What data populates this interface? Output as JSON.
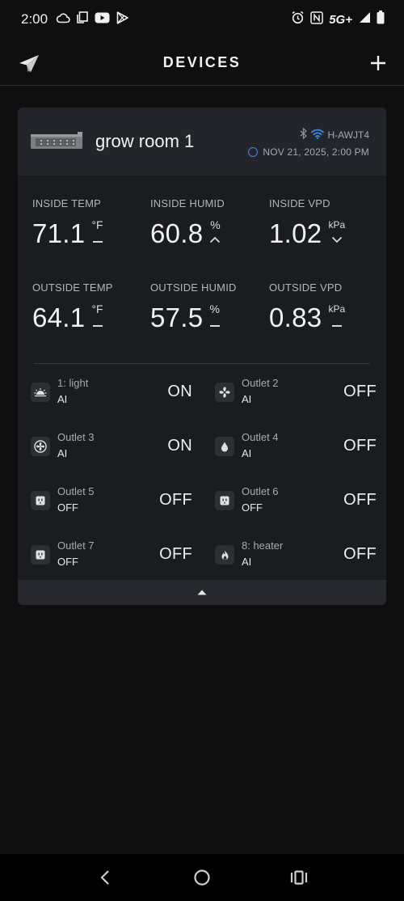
{
  "status_bar": {
    "time": "2:00",
    "network": "5G+",
    "left_icons": [
      "cloud-icon",
      "copy-icon",
      "youtube-icon",
      "play-store-icon"
    ],
    "right_icons": [
      "alarm-icon",
      "nfc-icon",
      "signal-icon",
      "battery-icon"
    ]
  },
  "header": {
    "title": "DEVICES"
  },
  "device": {
    "name": "grow room 1",
    "connection_id": "H-AWJT4",
    "timestamp": "NOV 21, 2025, 2:00 PM",
    "colors": {
      "wifi": "#3b8be0",
      "status_ring": "#4a86d8"
    }
  },
  "metrics": [
    {
      "label": "INSIDE TEMP",
      "value": "71.1",
      "unit": "°F",
      "trend": "flat"
    },
    {
      "label": "INSIDE HUMID",
      "value": "60.8",
      "unit": "%",
      "trend": "up"
    },
    {
      "label": "INSIDE VPD",
      "value": "1.02",
      "unit": "kPa",
      "trend": "down"
    },
    {
      "label": "OUTSIDE TEMP",
      "value": "64.1",
      "unit": "°F",
      "trend": "flat"
    },
    {
      "label": "OUTSIDE HUMID",
      "value": "57.5",
      "unit": "%",
      "trend": "flat"
    },
    {
      "label": "OUTSIDE VPD",
      "value": "0.83",
      "unit": "kPa",
      "trend": "flat"
    }
  ],
  "outlets": [
    {
      "name": "1: light",
      "mode": "AI",
      "state": "ON",
      "icon": "light-icon"
    },
    {
      "name": "Outlet 2",
      "mode": "AI",
      "state": "OFF",
      "icon": "fan-icon"
    },
    {
      "name": "Outlet 3",
      "mode": "AI",
      "state": "ON",
      "icon": "circulation-fan-icon"
    },
    {
      "name": "Outlet 4",
      "mode": "AI",
      "state": "OFF",
      "icon": "water-drop-icon"
    },
    {
      "name": "Outlet 5",
      "mode": "OFF",
      "state": "OFF",
      "icon": "plug-icon"
    },
    {
      "name": "Outlet 6",
      "mode": "OFF",
      "state": "OFF",
      "icon": "plug-icon"
    },
    {
      "name": "Outlet 7",
      "mode": "OFF",
      "state": "OFF",
      "icon": "plug-icon"
    },
    {
      "name": "8: heater",
      "mode": "AI",
      "state": "OFF",
      "icon": "flame-icon"
    }
  ],
  "nav": {
    "buttons": [
      "back-icon",
      "home-icon",
      "recents-icon"
    ]
  }
}
